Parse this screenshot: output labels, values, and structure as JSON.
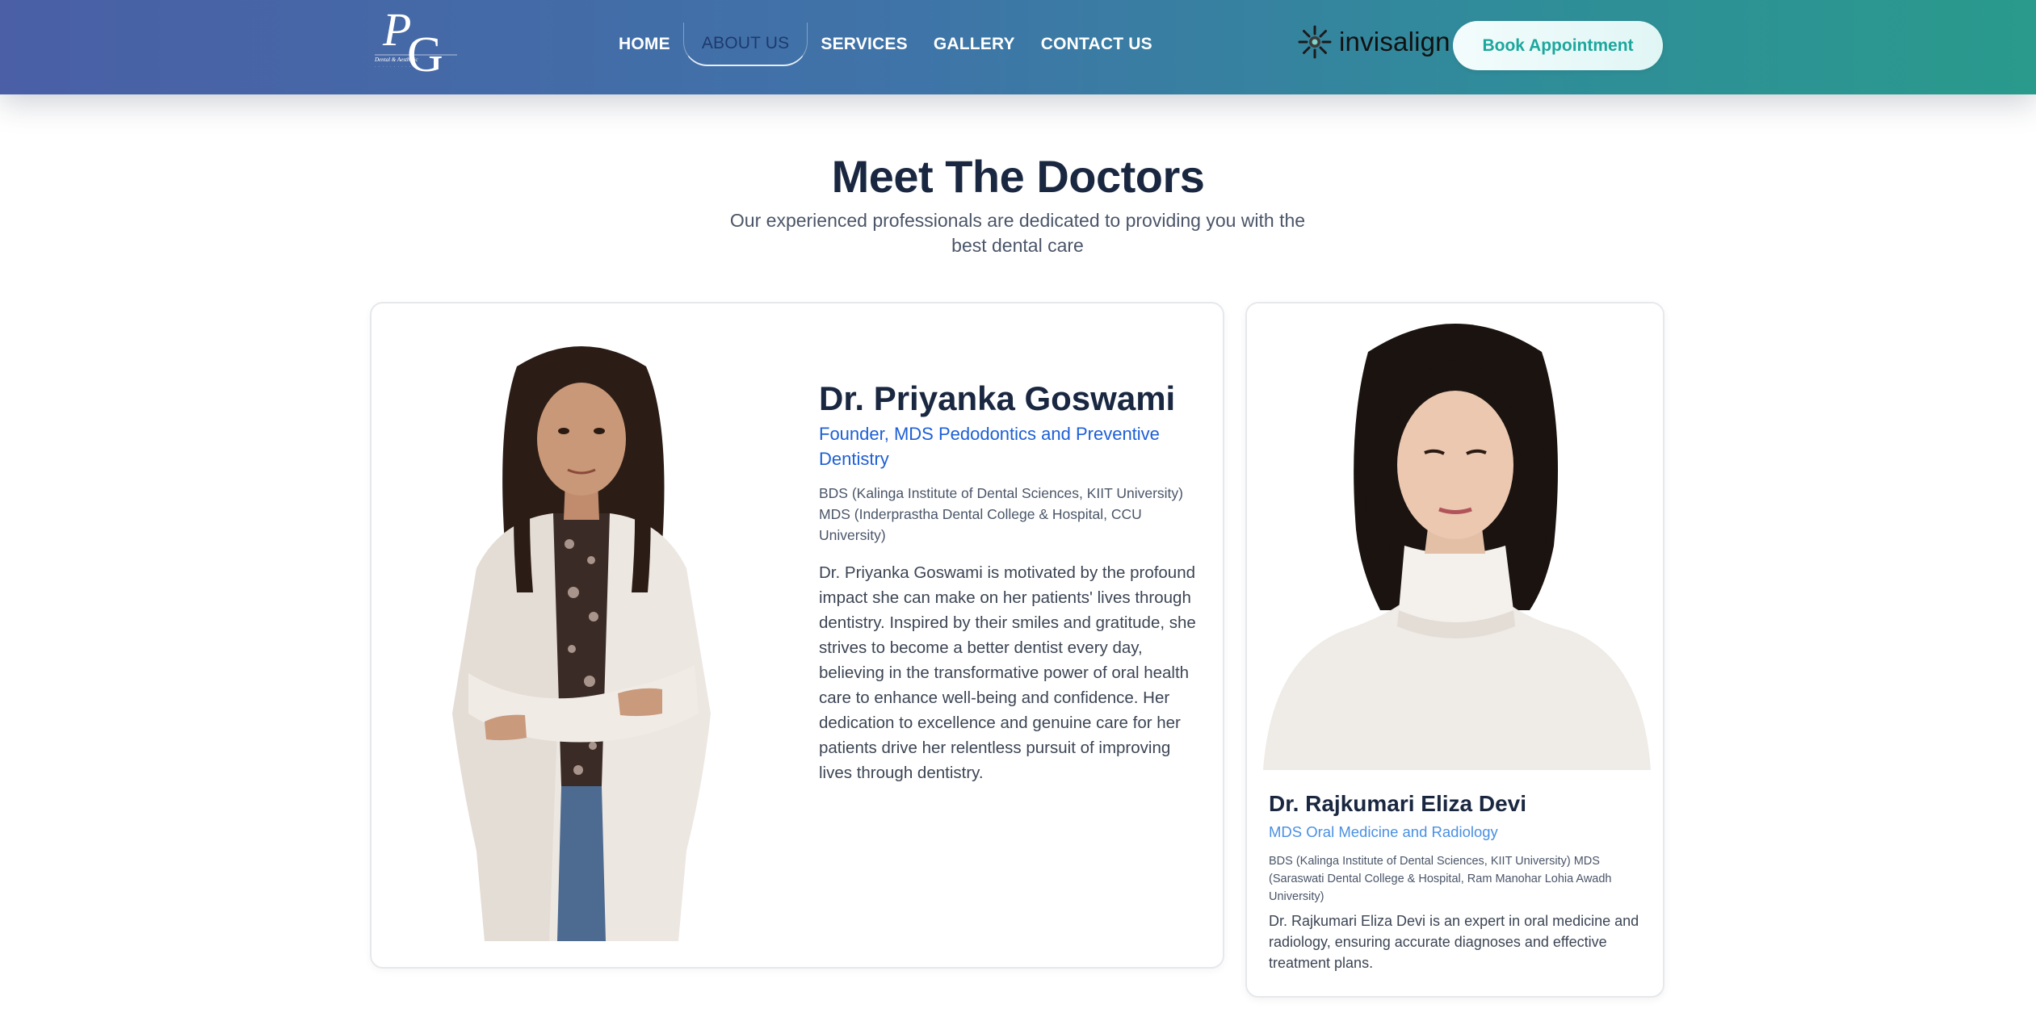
{
  "header": {
    "logo_alt": "Dental & Aesthetic",
    "nav": [
      {
        "label": "HOME",
        "active": false
      },
      {
        "label": "ABOUT US",
        "active": true
      },
      {
        "label": "SERVICES",
        "active": false
      },
      {
        "label": "GALLERY",
        "active": false
      },
      {
        "label": "CONTACT US",
        "active": false
      }
    ],
    "partner_brand": "invisalign",
    "book_button": "Book Appointment"
  },
  "section": {
    "title": "Meet The Doctors",
    "subtitle": "Our experienced professionals are dedicated to providing you with the best dental care"
  },
  "doctors": [
    {
      "name": "Dr. Priyanka Goswami",
      "role": "Founder, MDS Pedodontics and Preventive Dentistry",
      "education": "BDS (Kalinga Institute of Dental Sciences, KIIT University) MDS (Inderprastha Dental College & Hospital, CCU University)",
      "bio": "Dr. Priyanka Goswami is motivated by the profound impact she can make on her patients' lives through dentistry. Inspired by their smiles and gratitude, she strives to become a better dentist every day, believing in the transformative power of oral health care to enhance well-being and confidence. Her dedication to excellence and genuine care for her patients drive her relentless pursuit of improving lives through dentistry."
    },
    {
      "name": "Dr. Rajkumari Eliza Devi",
      "role": "MDS Oral Medicine and Radiology",
      "education": "BDS (Kalinga Institute of Dental Sciences, KIIT University) MDS (Saraswati Dental College & Hospital, Ram Manohar Lohia Awadh University)",
      "bio": "Dr. Rajkumari Eliza Devi is an expert in oral medicine and radiology, ensuring accurate diagnoses and effective treatment plans."
    }
  ],
  "colors": {
    "header_gradient_start": "#4a5fa6",
    "header_gradient_end": "#2a9a8c",
    "accent_teal": "#1ca79d",
    "role_blue": "#1d5fd6",
    "role_blue_light": "#4a90e2",
    "heading": "#1a2740"
  }
}
